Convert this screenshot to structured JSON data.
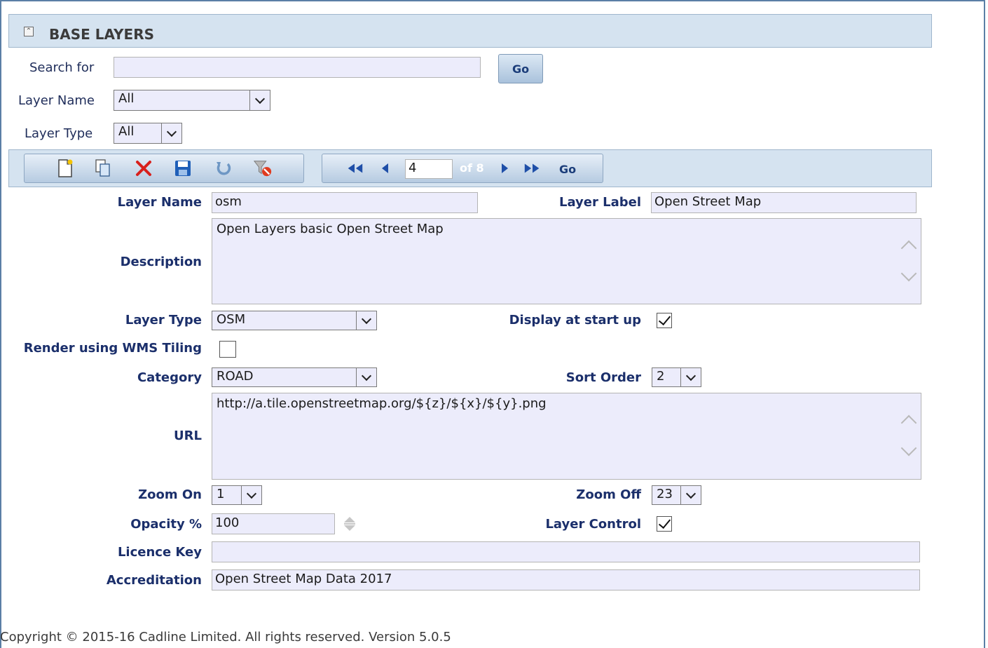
{
  "header": {
    "title": "BASE LAYERS",
    "collapse_icon": "collapse-up-icon"
  },
  "search": {
    "label": "Search for",
    "value": "",
    "go_label": "Go",
    "layer_name_label": "Layer Name",
    "layer_name_value": "All",
    "layer_type_label": "Layer Type",
    "layer_type_value": "All"
  },
  "toolbar": {
    "icons": [
      "new-record-icon",
      "copy-record-icon",
      "delete-record-icon",
      "save-record-icon",
      "undo-icon",
      "clear-filter-icon"
    ],
    "pager": {
      "current_page": "4",
      "of_text": "of 8",
      "go_label": "Go"
    }
  },
  "form": {
    "layer_name_label": "Layer Name",
    "layer_name_value": "osm",
    "layer_label_label": "Layer Label",
    "layer_label_value": "Open Street Map",
    "description_label": "Description",
    "description_value": "Open Layers basic Open Street Map",
    "layer_type_label": "Layer Type",
    "layer_type_value": "OSM",
    "display_startup_label": "Display at start up",
    "display_startup_checked": true,
    "wms_tiling_label": "Render using WMS Tiling",
    "wms_tiling_checked": false,
    "category_label": "Category",
    "category_value": "ROAD",
    "sort_order_label": "Sort Order",
    "sort_order_value": "2",
    "url_label": "URL",
    "url_value": "http://a.tile.openstreetmap.org/${z}/${x}/${y}.png",
    "zoom_on_label": "Zoom On",
    "zoom_on_value": "1",
    "zoom_off_label": "Zoom Off",
    "zoom_off_value": "23",
    "opacity_label": "Opacity %",
    "opacity_value": "100",
    "layer_control_label": "Layer Control",
    "layer_control_checked": true,
    "licence_key_label": "Licence Key",
    "licence_key_value": "",
    "accreditation_label": "Accreditation",
    "accreditation_value": "Open Street Map Data 2017"
  },
  "footer": {
    "copyright": "Copyright © 2015-16 Cadline Limited. All rights reserved. Version 5.0.5"
  },
  "colors": {
    "panel_bg": "#d5e3f0",
    "label_blue": "#1b2f6b",
    "input_bg": "#ececfb",
    "delete_red": "#d8201c"
  }
}
